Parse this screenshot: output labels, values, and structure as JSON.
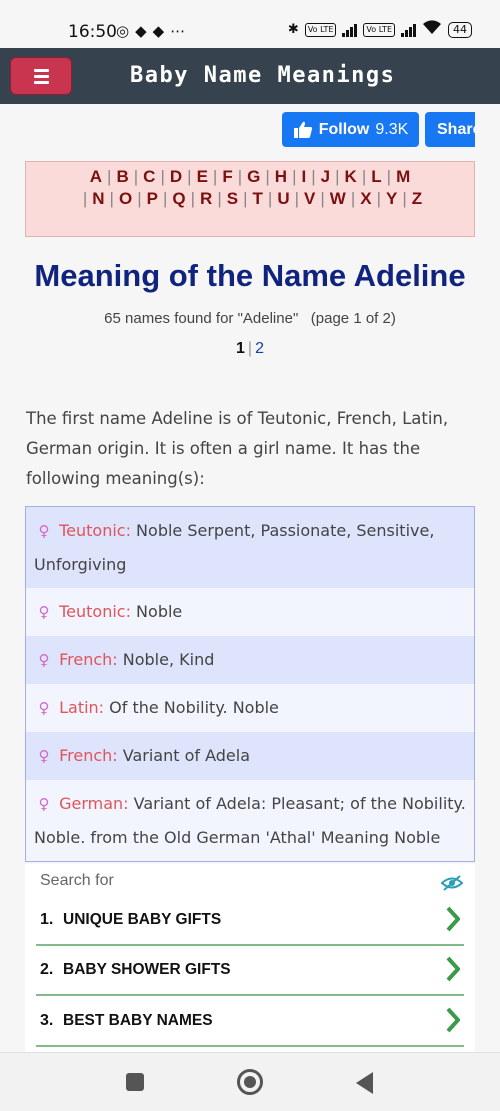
{
  "status": {
    "time": "16:50",
    "battery": "44",
    "lte_label": "Vo LTE"
  },
  "header": {
    "title": "Baby Name Meanings",
    "menu_icon": "hamburger-menu-icon"
  },
  "social": {
    "follow_label": "Follow",
    "follow_count": "9.3K",
    "share_label": "Share"
  },
  "alphabet": [
    "A",
    "B",
    "C",
    "D",
    "E",
    "F",
    "G",
    "H",
    "I",
    "J",
    "K",
    "L",
    "M",
    "N",
    "O",
    "P",
    "Q",
    "R",
    "S",
    "T",
    "U",
    "V",
    "W",
    "X",
    "Y",
    "Z"
  ],
  "page": {
    "title": "Meaning of the Name Adeline",
    "found_text": "65 names found for \"Adeline\"",
    "page_info": "(page 1 of 2)",
    "pages": [
      "1",
      "2"
    ],
    "current_page": "1"
  },
  "intro": "The first name Adeline is of Teutonic, French, Latin, German origin. It is often a girl name. It has the following meaning(s):",
  "meanings": [
    {
      "origin": "Teutonic:",
      "text": " Noble Serpent, Passionate, Sensitive, Unforgiving"
    },
    {
      "origin": "Teutonic:",
      "text": " Noble"
    },
    {
      "origin": "French:",
      "text": " Noble, Kind"
    },
    {
      "origin": "Latin:",
      "text": " Of the Nobility. Noble"
    },
    {
      "origin": "French:",
      "text": " Variant of Adela"
    },
    {
      "origin": "German:",
      "text": " Variant of Adela: Pleasant; of the Nobility. Noble. from the Old German 'Athal' Meaning Noble"
    }
  ],
  "search": {
    "label": "Search for",
    "items": [
      {
        "num": "1.",
        "text": "UNIQUE BABY GIFTS"
      },
      {
        "num": "2.",
        "text": "BABY SHOWER GIFTS"
      },
      {
        "num": "3.",
        "text": "BEST BABY NAMES"
      }
    ]
  },
  "colors": {
    "header_bg": "#36434e",
    "menu_button": "#c9344e",
    "facebook": "#1877f2",
    "title": "#10237e",
    "origin": "#e0545a",
    "female_icon": "#d667c8",
    "search_divider": "#84b98a",
    "chevron": "#3a9a4a"
  }
}
